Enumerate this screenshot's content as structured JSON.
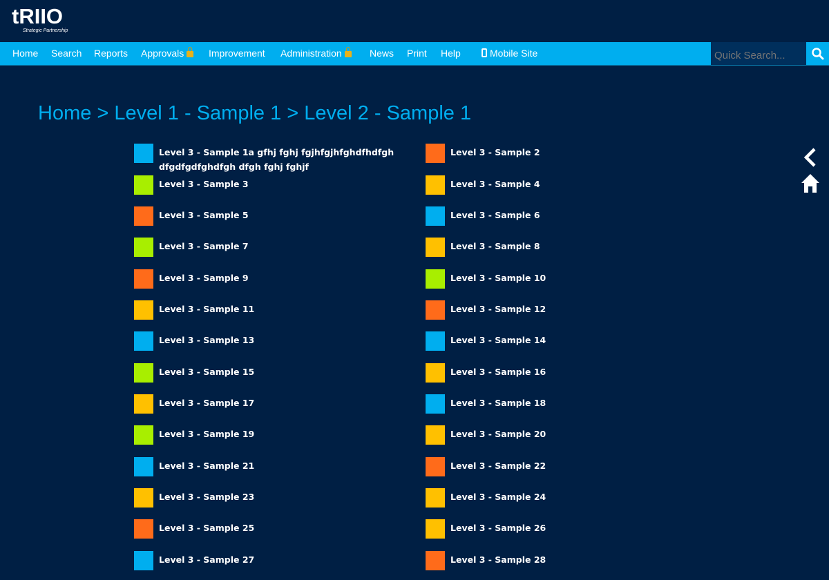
{
  "logo": {
    "text": "tRIIO",
    "tagline": "Strategic Partnership"
  },
  "nav": {
    "items": [
      {
        "label": "Home"
      },
      {
        "label": "Search"
      },
      {
        "label": "Reports"
      },
      {
        "label": "Approvals"
      },
      {
        "label": "Improvement"
      },
      {
        "label": "Administration"
      },
      {
        "label": "News"
      },
      {
        "label": "Print"
      },
      {
        "label": "Help"
      },
      {
        "label": "Mobile Site"
      }
    ],
    "search_placeholder": "Quick Search..."
  },
  "breadcrumb": {
    "items": [
      "Home",
      "Level 1 - Sample 1",
      "Level 2 - Sample 1"
    ],
    "separator": ">"
  },
  "colors": {
    "background": "#001f44",
    "nav_bar": "#00aeef",
    "search_box": "#002f5c",
    "blue": "#00aeef",
    "orange": "#ff6b1a",
    "green": "#a8ee00",
    "yellow": "#ffc000"
  },
  "items": [
    {
      "label": "Level 3 - Sample 1a gfhj fghj fgjhfgjhfghdfhdfgh dfgdfgdfghdfgh dfgh fghj fghjf",
      "color": "blue"
    },
    {
      "label": "Level 3 - Sample 2",
      "color": "orange"
    },
    {
      "label": "Level 3 - Sample 3",
      "color": "green"
    },
    {
      "label": "Level 3 - Sample 4",
      "color": "yellow"
    },
    {
      "label": "Level 3 - Sample 5",
      "color": "orange"
    },
    {
      "label": "Level 3 - Sample 6",
      "color": "blue"
    },
    {
      "label": "Level 3 - Sample 7",
      "color": "green"
    },
    {
      "label": "Level 3 - Sample 8",
      "color": "yellow"
    },
    {
      "label": "Level 3 - Sample 9",
      "color": "orange"
    },
    {
      "label": "Level 3 - Sample 10",
      "color": "green"
    },
    {
      "label": "Level 3 - Sample 11",
      "color": "yellow"
    },
    {
      "label": "Level 3 - Sample 12",
      "color": "orange"
    },
    {
      "label": "Level 3 - Sample 13",
      "color": "blue"
    },
    {
      "label": "Level 3 - Sample 14",
      "color": "blue"
    },
    {
      "label": "Level 3 - Sample 15",
      "color": "green"
    },
    {
      "label": "Level 3 - Sample 16",
      "color": "yellow"
    },
    {
      "label": "Level 3 - Sample 17",
      "color": "yellow"
    },
    {
      "label": "Level 3 - Sample 18",
      "color": "blue"
    },
    {
      "label": "Level 3 - Sample 19",
      "color": "green"
    },
    {
      "label": "Level 3 - Sample 20",
      "color": "yellow"
    },
    {
      "label": "Level 3 - Sample 21",
      "color": "blue"
    },
    {
      "label": "Level 3 - Sample 22",
      "color": "orange"
    },
    {
      "label": "Level 3 - Sample 23",
      "color": "yellow"
    },
    {
      "label": "Level 3 - Sample 24",
      "color": "yellow"
    },
    {
      "label": "Level 3 - Sample 25",
      "color": "orange"
    },
    {
      "label": "Level 3 - Sample 26",
      "color": "yellow"
    },
    {
      "label": "Level 3 - Sample 27",
      "color": "blue"
    },
    {
      "label": "Level 3 - Sample 28",
      "color": "orange"
    }
  ],
  "side_controls": [
    {
      "icon": "chevron-left-icon"
    },
    {
      "icon": "home-icon"
    }
  ]
}
